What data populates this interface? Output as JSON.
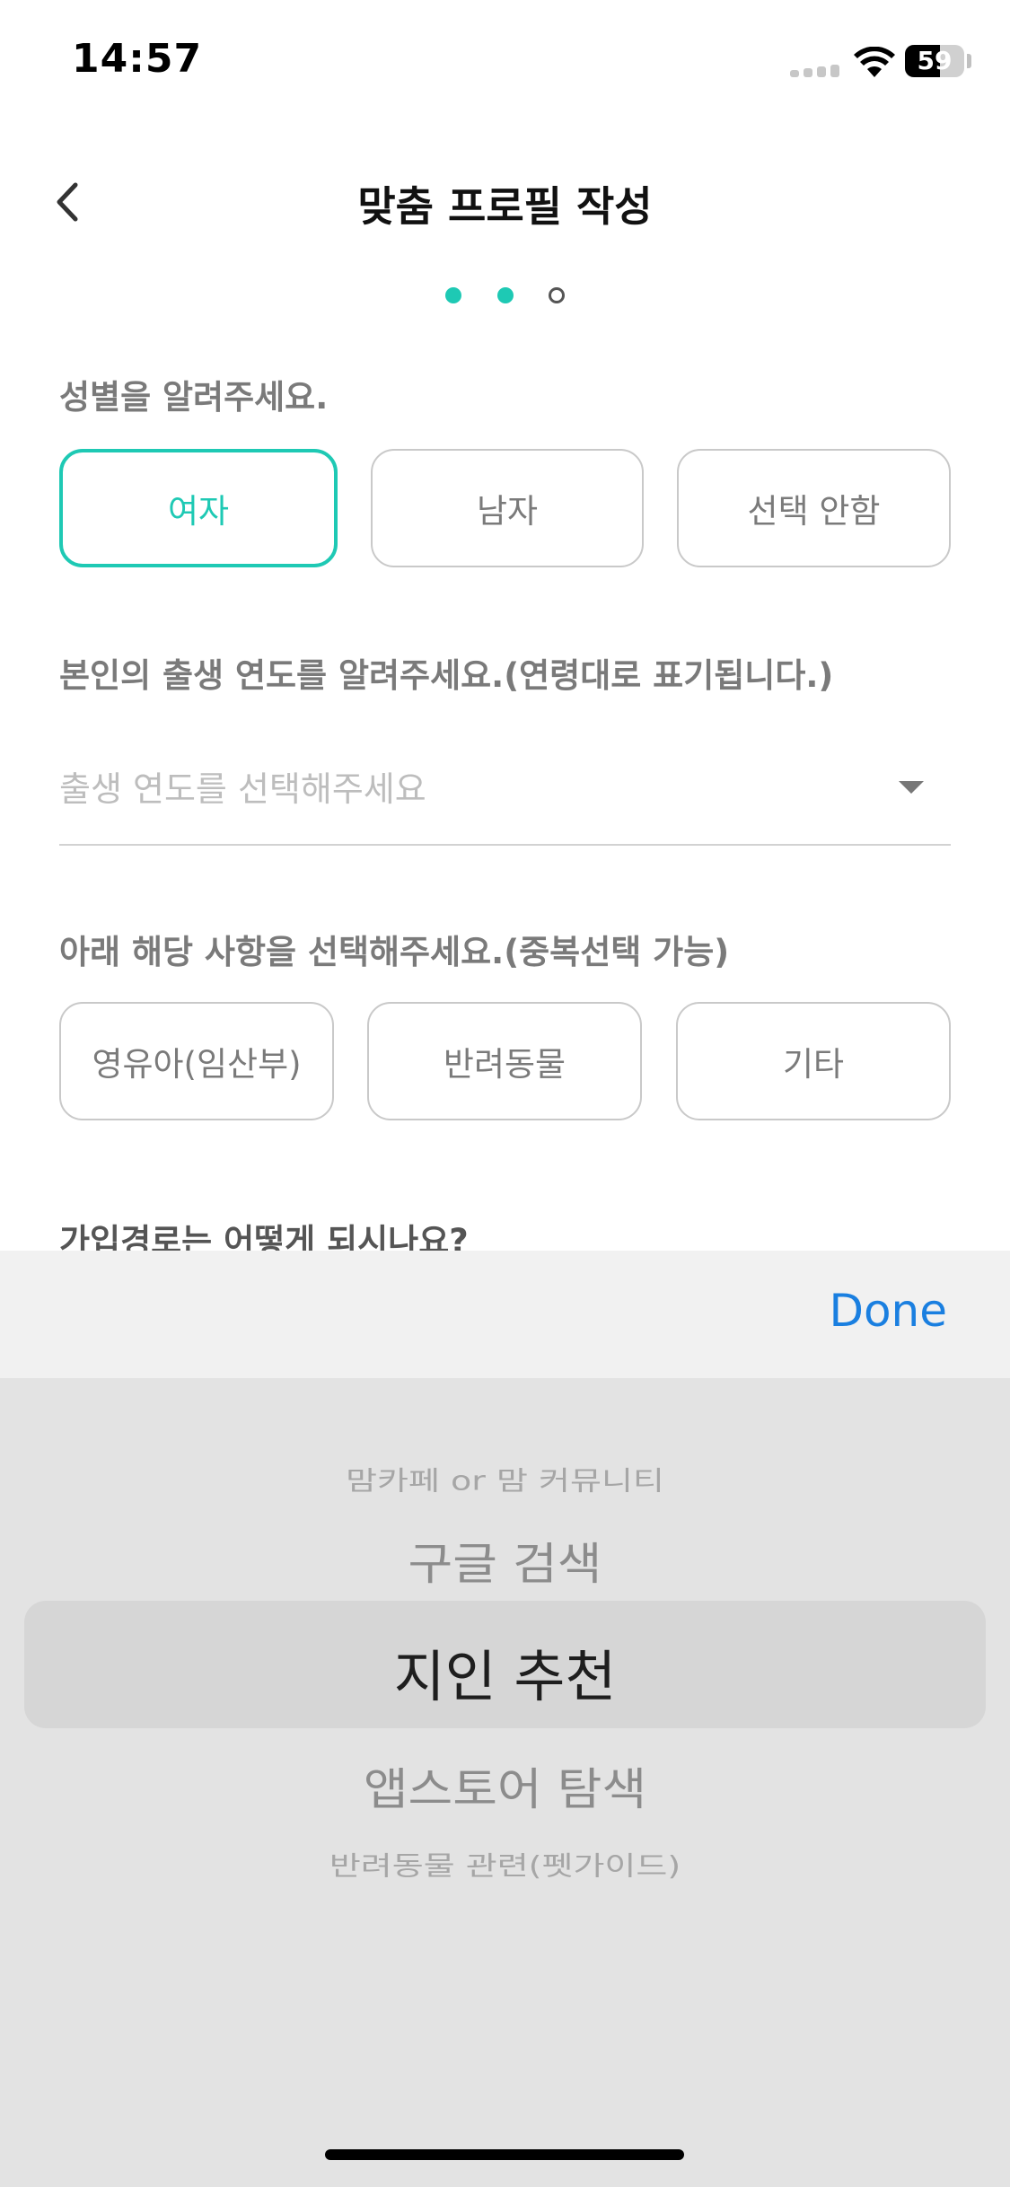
{
  "status_bar": {
    "time": "14:57",
    "battery_level": "59",
    "battery_fraction": 0.59
  },
  "header": {
    "title": "맞춤 프로필 작성",
    "back_icon": "chevron-left-icon"
  },
  "pagination": {
    "total": 3,
    "filled": 2
  },
  "gender_section": {
    "label": "성별을 알려주세요.",
    "options": [
      "여자",
      "남자",
      "선택 안함"
    ],
    "selected": "여자"
  },
  "birth_year_section": {
    "label": "본인의 출생 연도를 알려주세요.(연령대로 표기됩니다.)",
    "placeholder": "출생 연도를 선택해주세요",
    "caret_icon": "caret-down-icon"
  },
  "category_section": {
    "label": "아래 해당 사항을 선택해주세요.(중복선택 가능)",
    "options": [
      "영유아(임산부)",
      "반려동물",
      "기타"
    ]
  },
  "signup_route_section": {
    "label": "가입경로는 어떻게 되시나요?"
  },
  "picker": {
    "done_label": "Done",
    "items": [
      "맘카페 or 맘 커뮤니티",
      "구글 검색",
      "지인 추천",
      "앱스토어 탐색",
      "반려동물 관련(펫가이드)"
    ],
    "selected": "지인 추천"
  },
  "colors": {
    "accent": "#1ec9b4",
    "done_blue": "#1a7fe0",
    "label_gray": "#7a7a7a"
  }
}
